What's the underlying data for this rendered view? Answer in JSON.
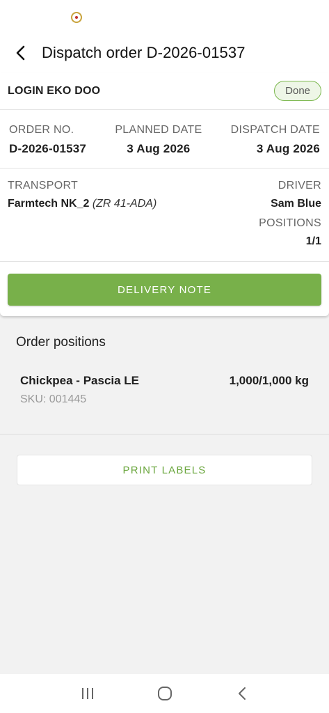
{
  "header": {
    "title": "Dispatch order D-2026-01537"
  },
  "card": {
    "company": "LOGIN EKO DOO",
    "status": "Done",
    "order_no_label": "ORDER NO.",
    "order_no": "D-2026-01537",
    "planned_date_label": "PLANNED DATE",
    "planned_date": "3 Aug 2026",
    "dispatch_date_label": "DISPATCH DATE",
    "dispatch_date": "3 Aug 2026",
    "transport_label": "TRANSPORT",
    "transport_name": "Farmtech NK_2",
    "transport_plate": "(ZR 41-ADA)",
    "driver_label": "DRIVER",
    "driver": "Sam Blue",
    "positions_label": "POSITIONS",
    "positions": "1/1",
    "delivery_note_label": "DELIVERY NOTE"
  },
  "positions_section": {
    "title": "Order positions",
    "items": [
      {
        "name": "Chickpea - Pascia LE",
        "quantity": "1,000/1,000 kg",
        "sku": "SKU: 001445"
      }
    ]
  },
  "print_labels": "PRINT LABELS",
  "colors": {
    "accent": "#78b04a",
    "badge_border": "#7cb84f",
    "print_text": "#6aa63d"
  },
  "nav": {
    "icons": [
      "recent-apps-icon",
      "home-icon",
      "back-icon"
    ]
  }
}
